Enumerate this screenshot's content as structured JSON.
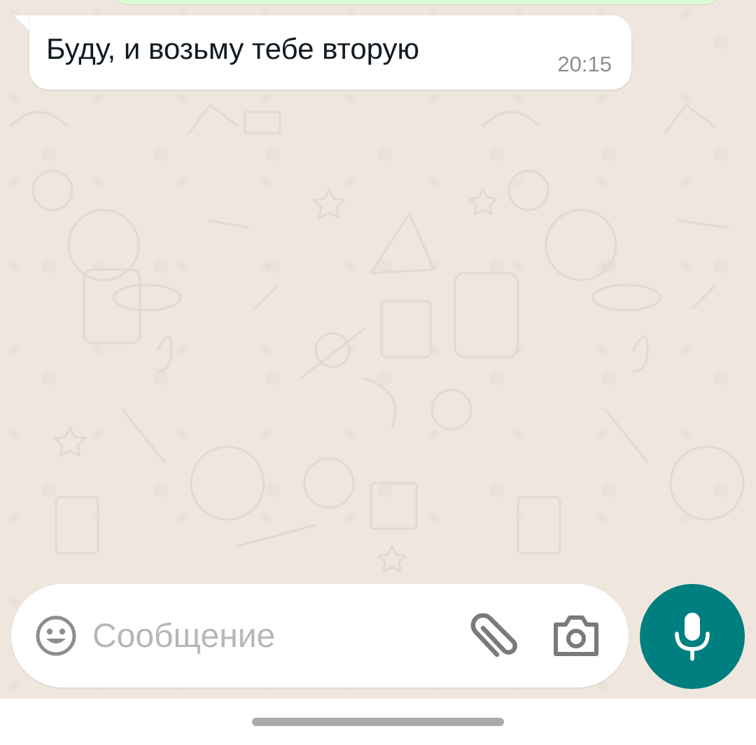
{
  "chat": {
    "messages": [
      {
        "direction": "incoming",
        "text": "Буду, и возьму тебе вторую",
        "time": "20:15"
      }
    ]
  },
  "composer": {
    "placeholder": "Сообщение",
    "icons": {
      "emoji": "emoji-icon",
      "attach": "paperclip-icon",
      "camera": "camera-icon",
      "voice": "microphone-icon"
    }
  },
  "colors": {
    "wallpaper": "#efe7de",
    "incoming_bubble": "#ffffff",
    "outgoing_bubble": "#d9fdd3",
    "accent": "#007f80",
    "timestamp": "#8a9095",
    "placeholder": "#b7b7b7"
  }
}
